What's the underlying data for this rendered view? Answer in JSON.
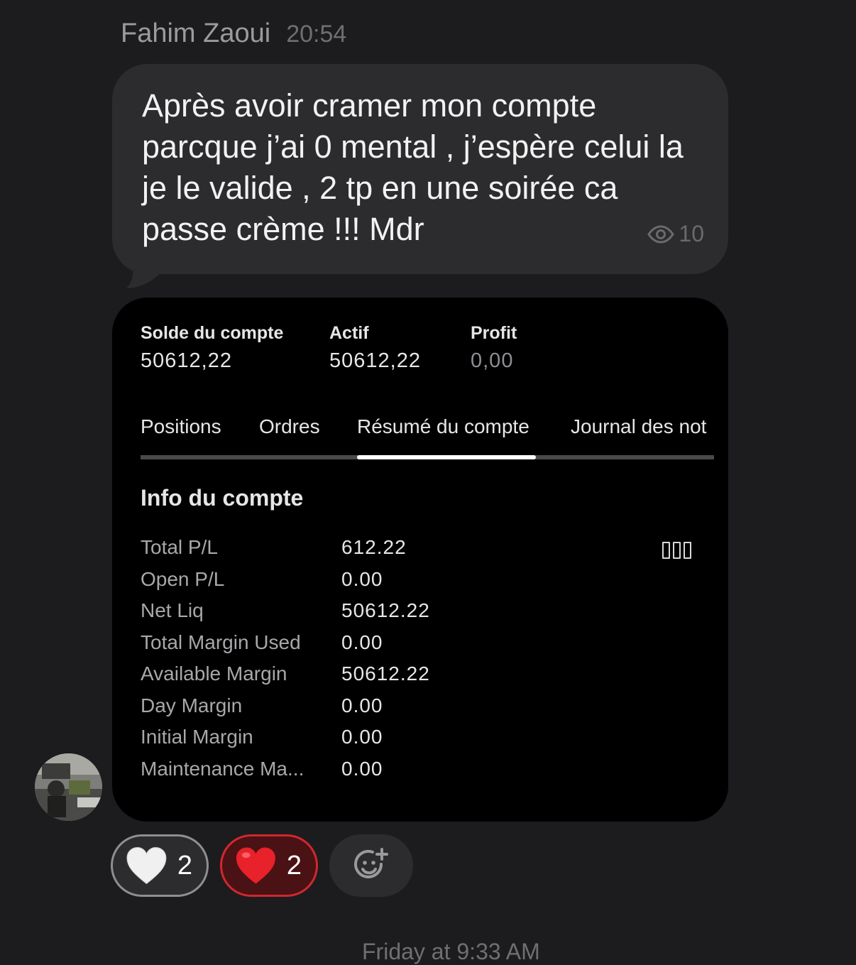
{
  "message": {
    "sender": "Fahim Zaoui",
    "time": "20:54",
    "text": "Après avoir cramer mon compte parcque j’ai 0 mental , j’espère celui la je le valide , 2 tp en une soirée ca passe crème !!! Mdr",
    "views": "10"
  },
  "account": {
    "summary": [
      {
        "label": "Solde du compte",
        "value": "50612,22"
      },
      {
        "label": "Actif",
        "value": "50612,22"
      },
      {
        "label": "Profit",
        "value": "0,00"
      }
    ],
    "tabs": [
      {
        "label": "Positions",
        "active": false
      },
      {
        "label": "Ordres",
        "active": false
      },
      {
        "label": "Résumé du compte",
        "active": true
      },
      {
        "label": "Journal des not",
        "active": false
      }
    ],
    "section_title": "Info du compte",
    "rows": [
      {
        "label": "Total P/L",
        "value": "612.22"
      },
      {
        "label": "Open P/L",
        "value": "0.00"
      },
      {
        "label": "Net Liq",
        "value": "50612.22"
      },
      {
        "label": "Total Margin Used",
        "value": "0.00"
      },
      {
        "label": "Available Margin",
        "value": "50612.22"
      },
      {
        "label": "Day Margin",
        "value": "0.00"
      },
      {
        "label": "Initial Margin",
        "value": "0.00"
      },
      {
        "label": "Maintenance Ma...",
        "value": "0.00"
      }
    ],
    "column_icon": "columns-icon"
  },
  "reactions": [
    {
      "emoji": "white-heart",
      "count": "2",
      "selected": false
    },
    {
      "emoji": "red-heart",
      "count": "2",
      "selected": true
    }
  ],
  "add_reaction_icon": "add-reaction-icon",
  "next_message_time": "Friday at 9:33 AM"
}
